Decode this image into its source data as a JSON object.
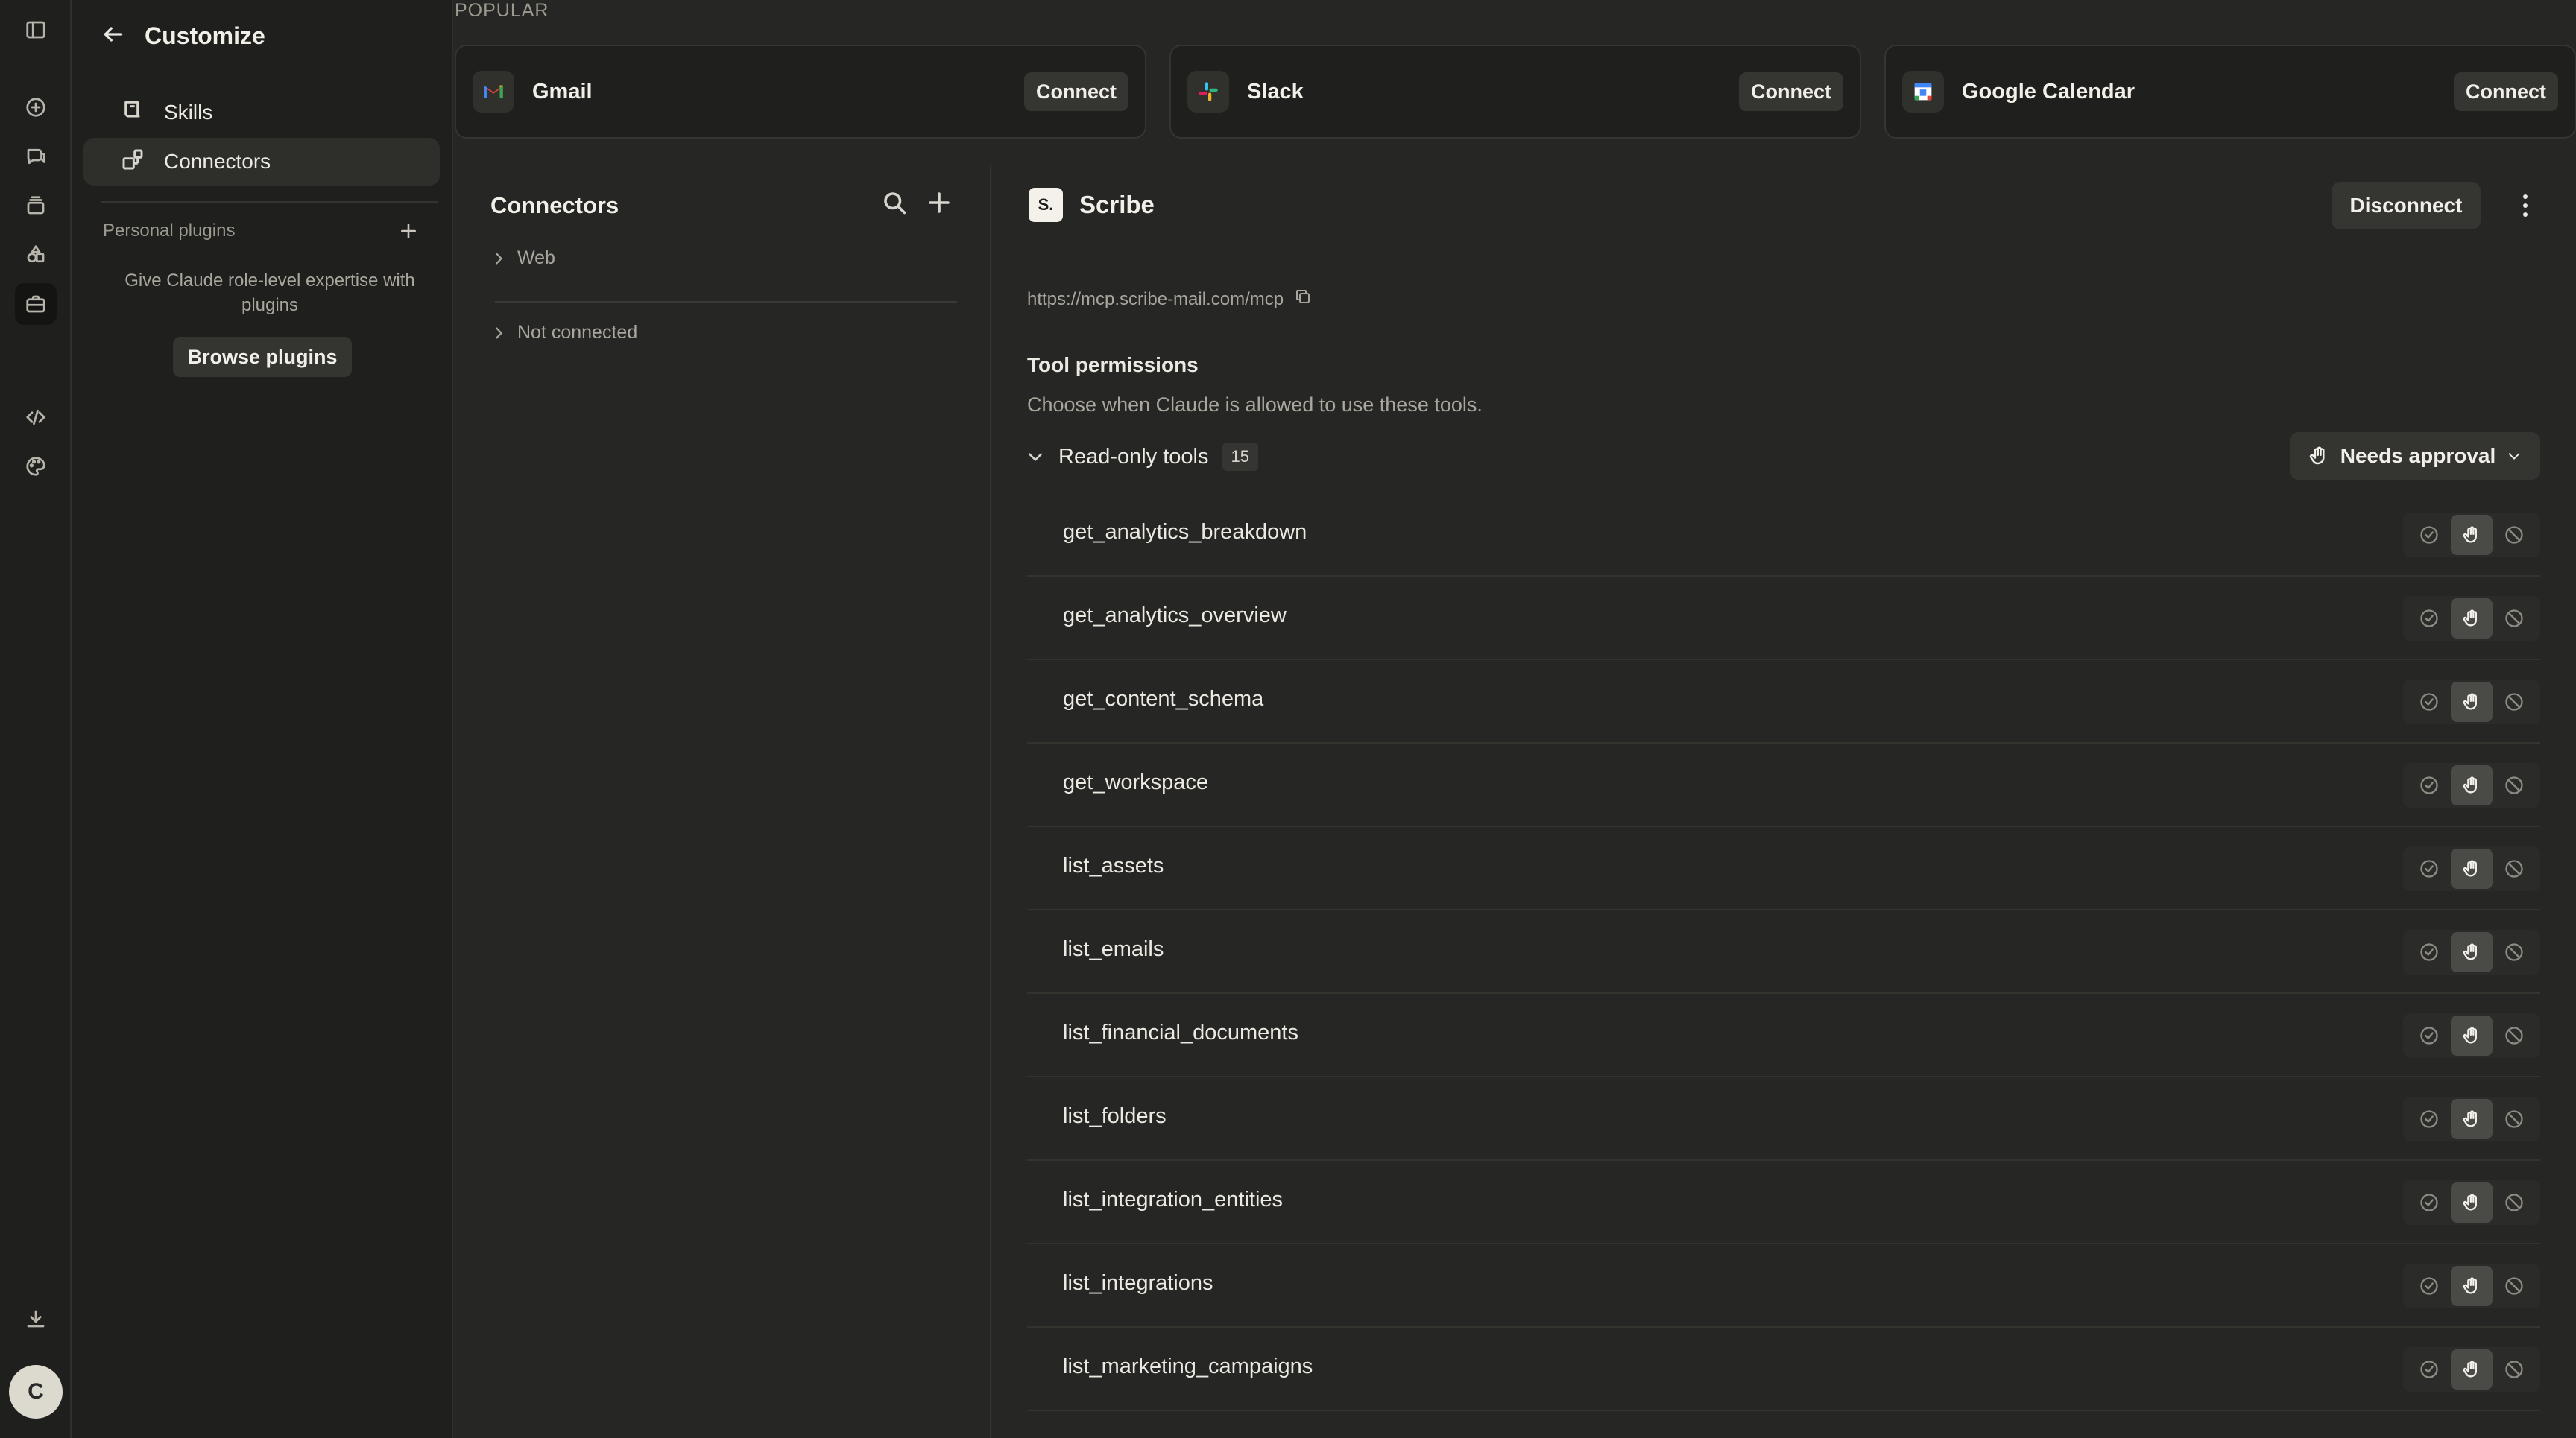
{
  "header": {
    "title": "Customize"
  },
  "sidebar": {
    "items": [
      {
        "label": "Skills"
      },
      {
        "label": "Connectors"
      }
    ],
    "personal_plugins_label": "Personal plugins",
    "plugins_description": "Give Claude role-level expertise with plugins",
    "browse_button": "Browse plugins"
  },
  "user": {
    "initial": "C"
  },
  "popular": {
    "label": "POPULAR",
    "cards": [
      {
        "name": "Gmail",
        "action": "Connect"
      },
      {
        "name": "Slack",
        "action": "Connect"
      },
      {
        "name": "Google Calendar",
        "action": "Connect"
      }
    ]
  },
  "connectors_list": {
    "title": "Connectors",
    "groups": [
      {
        "label": "Web"
      },
      {
        "label": "Not connected"
      }
    ]
  },
  "detail": {
    "logo_text": "S.",
    "title": "Scribe",
    "disconnect": "Disconnect",
    "url": "https://mcp.scribe-mail.com/mcp",
    "permissions_title": "Tool permissions",
    "permissions_desc": "Choose when Claude is allowed to use these tools.",
    "group_label": "Read-only tools",
    "group_count": "15",
    "group_setting": "Needs approval",
    "tools": [
      "get_analytics_breakdown",
      "get_analytics_overview",
      "get_content_schema",
      "get_workspace",
      "list_assets",
      "list_emails",
      "list_financial_documents",
      "list_folders",
      "list_integration_entities",
      "list_integrations",
      "list_marketing_campaigns"
    ],
    "selected_permission": "needs-approval"
  },
  "colors": {
    "background": "#262624",
    "sidebar": "#1f1f1d",
    "text": "#e9e7e1",
    "muted": "#a9a69d"
  }
}
